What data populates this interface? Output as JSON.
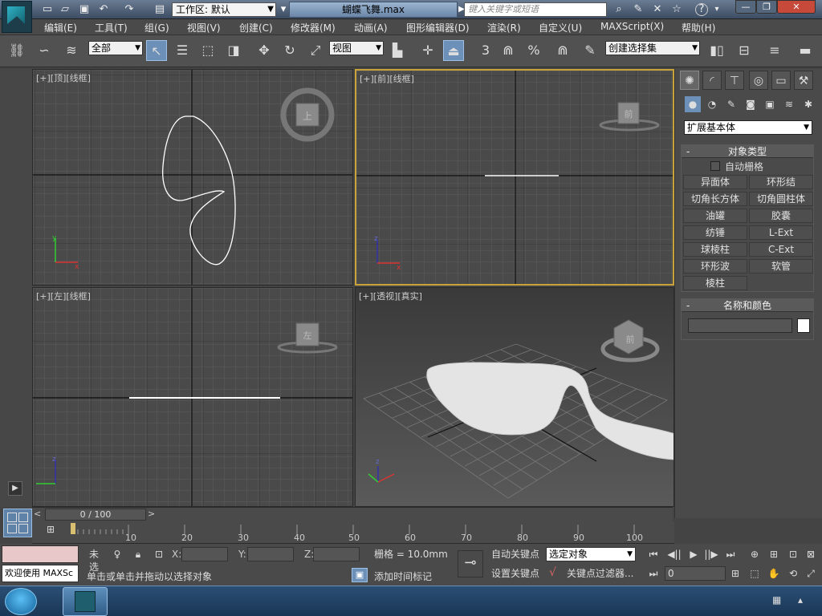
{
  "app": {
    "workspace": "工作区: 默认",
    "file_title": "蝴蝶飞舞.max",
    "search_placeholder": "键入关键字或短语"
  },
  "menu": [
    "编辑(E)",
    "工具(T)",
    "组(G)",
    "视图(V)",
    "创建(C)",
    "修改器(M)",
    "动画(A)",
    "图形编辑器(D)",
    "渲染(R)",
    "自定义(U)",
    "MAXScript(X)",
    "帮助(H)"
  ],
  "toolbar": {
    "selection_filter": "全部",
    "ref_coord": "视图",
    "named_selection": "创建选择集",
    "snap_3": "3",
    "snap_percent": "%"
  },
  "viewports": {
    "top_label": "[+][顶][线框]",
    "front_label": "[+][前][线框]",
    "left_label": "[+][左][线框]",
    "persp_label": "[+][透视][真实]",
    "cube_top": "上",
    "cube_front": "前",
    "cube_left": "左",
    "cube_persp": "前"
  },
  "command_panel": {
    "category": "扩展基本体",
    "object_type_title": "对象类型",
    "auto_grid": "自动栅格",
    "objects": [
      "异面体",
      "环形结",
      "切角长方体",
      "切角圆柱体",
      "油罐",
      "胶囊",
      "纺锤",
      "L-Ext",
      "球棱柱",
      "C-Ext",
      "环形波",
      "软管",
      "棱柱"
    ],
    "name_color_title": "名称和颜色"
  },
  "timeline": {
    "frame_counter": "0 / 100",
    "ticks": [
      "10",
      "20",
      "30",
      "40",
      "50",
      "60",
      "70",
      "80",
      "90",
      "100"
    ]
  },
  "status": {
    "welcome": "欢迎使用 MAXSc",
    "none_selected": "未选",
    "x_label": "X:",
    "y_label": "Y:",
    "z_label": "Z:",
    "grid": "栅格 = 10.0mm",
    "auto_key": "自动关键点",
    "selected_object": "选定对象",
    "set_key": "设置关键点",
    "key_filter": "关键点过滤器...",
    "hint": "单击或单击并拖动以选择对象",
    "add_time_tag": "添加时间标记",
    "frame_value": "0"
  },
  "colors": {
    "active_viewport": "#c9a23a",
    "viewport_bg": "#4a4a4a",
    "accent": "#6d90b8"
  }
}
